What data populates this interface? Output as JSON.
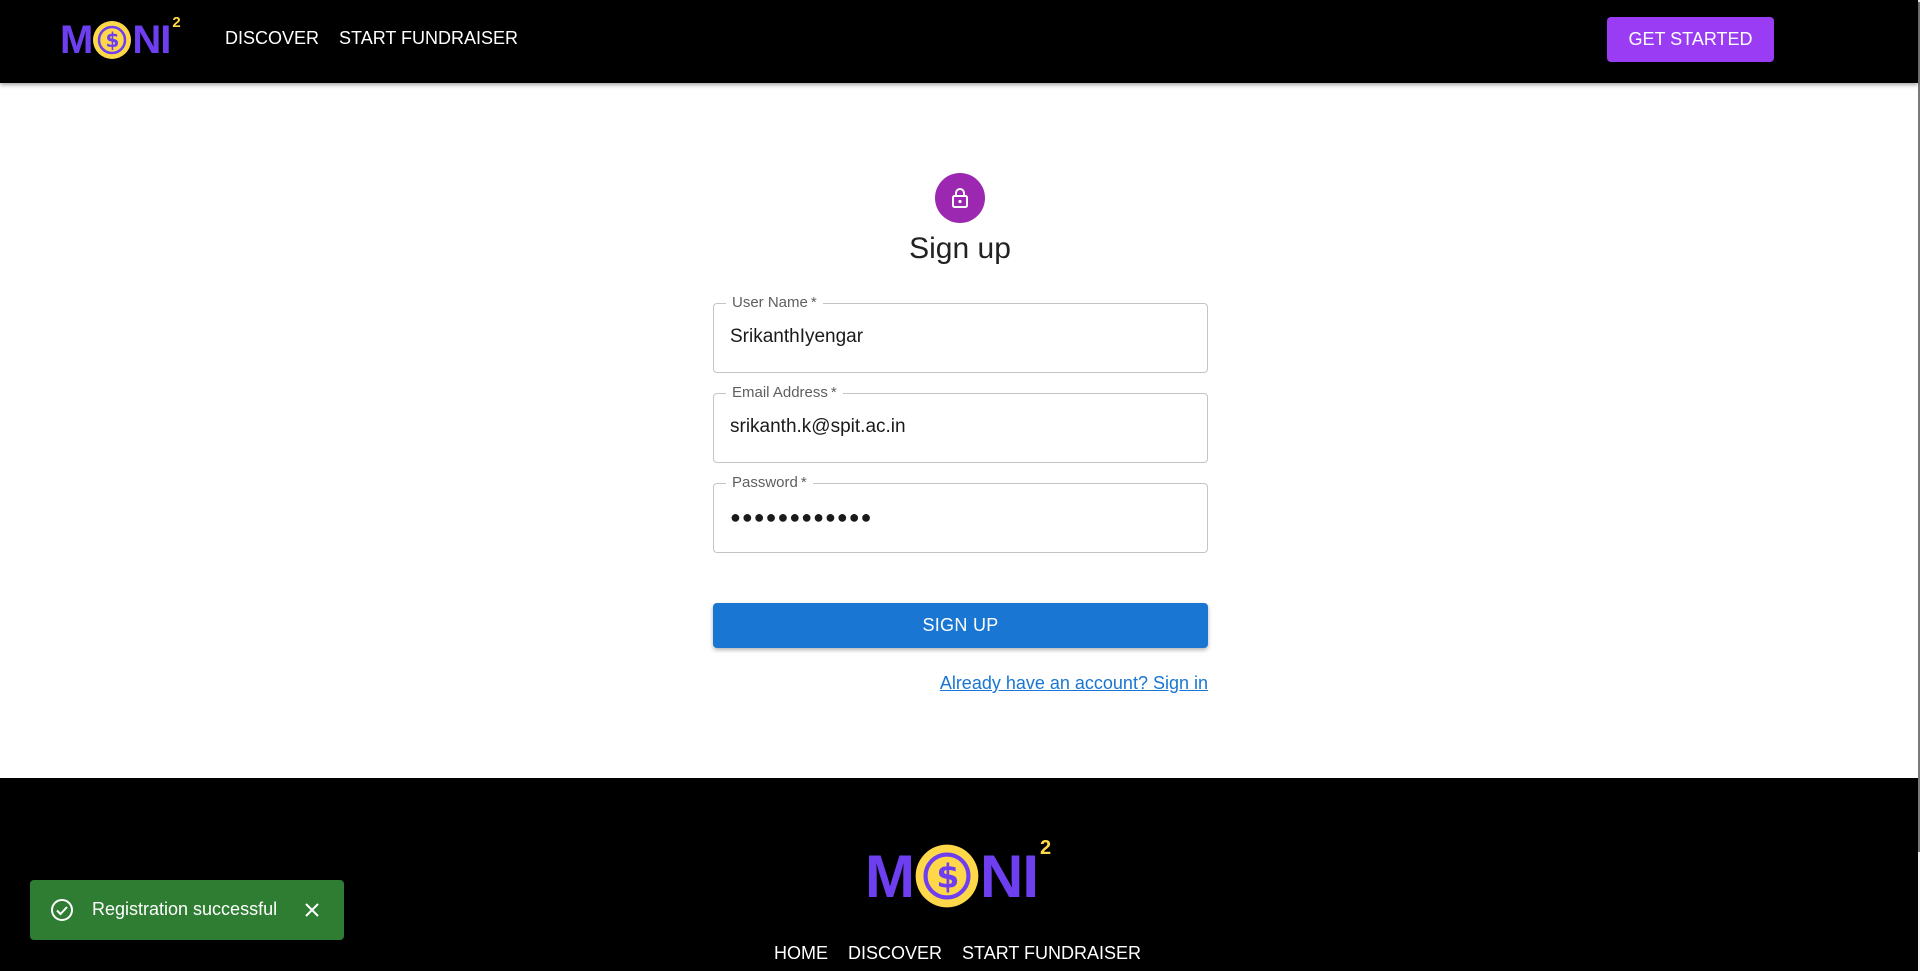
{
  "header": {
    "logo": {
      "text_before": "M",
      "text_after": "NI",
      "superscript": "2"
    },
    "nav": [
      "DISCOVER",
      "START FUNDRAISER"
    ],
    "cta_label": "GET STARTED"
  },
  "signup": {
    "icon": "lock-icon",
    "title": "Sign up",
    "fields": {
      "username": {
        "label": "User Name",
        "required_mark": "*",
        "value": "SrikanthIyengar"
      },
      "email": {
        "label": "Email Address",
        "required_mark": "*",
        "value": "srikanth.k@spit.ac.in"
      },
      "password": {
        "label": "Password",
        "required_mark": "*",
        "value": "●●●●●●●●●●●●"
      }
    },
    "submit_label": "SIGN UP",
    "signin_link": "Already have an account? Sign in"
  },
  "footer": {
    "logo": {
      "text_before": "M",
      "text_after": "NI",
      "superscript": "2"
    },
    "nav": [
      "HOME",
      "DISCOVER",
      "START FUNDRAISER"
    ]
  },
  "toast": {
    "icon": "check-circle-icon",
    "message": "Registration successful",
    "close_icon": "close-icon"
  },
  "colors": {
    "header_bg": "#000000",
    "accent_purple": "#9b3cf5",
    "logo_purple": "#6e3ff0",
    "coin_yellow": "#ffd84a",
    "avatar_purple": "#9c27b0",
    "primary_blue": "#1976d2",
    "success_green": "#2e7d32"
  }
}
